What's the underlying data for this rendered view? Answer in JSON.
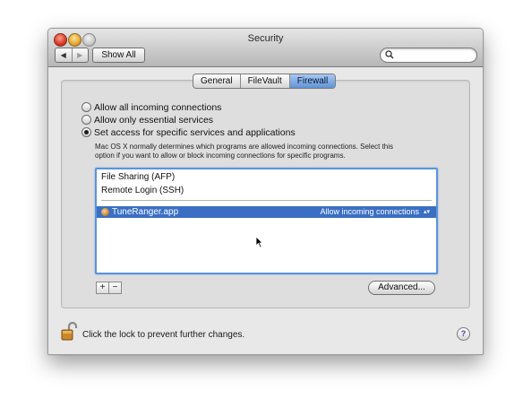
{
  "window": {
    "title": "Security",
    "nav": {
      "back_glyph": "◀",
      "forward_glyph": "▶"
    },
    "show_all_label": "Show All",
    "search": {
      "value": "",
      "placeholder": ""
    }
  },
  "tabs": [
    {
      "label": "General",
      "active": false
    },
    {
      "label": "FileVault",
      "active": false
    },
    {
      "label": "Firewall",
      "active": true
    }
  ],
  "firewall": {
    "options": [
      {
        "label": "Allow all incoming connections",
        "selected": false
      },
      {
        "label": "Allow only essential services",
        "selected": false
      },
      {
        "label": "Set access for specific services and applications",
        "selected": true
      }
    ],
    "description_line1": "Mac OS X normally determines which programs are allowed incoming connections. Select this",
    "description_line2": "option if you want to allow or block incoming connections for specific programs.",
    "services": [
      "File Sharing (AFP)",
      "Remote Login (SSH)"
    ],
    "applications": [
      {
        "name": "TuneRanger.app",
        "policy": "Allow incoming connections",
        "selected": true,
        "icon": "tuneranger-app-icon"
      }
    ],
    "add_label": "+",
    "remove_label": "−",
    "advanced_label": "Advanced..."
  },
  "footer": {
    "lock_text": "Click the lock to prevent further changes.",
    "help_label": "?"
  },
  "icons": {
    "search": "magnifier-icon",
    "lock": "open-lock-icon",
    "help": "help-icon",
    "stepper": "up-down-arrows-icon"
  },
  "colors": {
    "selection": "#3a6fc4",
    "focus_ring": "#5b93db",
    "active_tab": "#6a9de0"
  }
}
